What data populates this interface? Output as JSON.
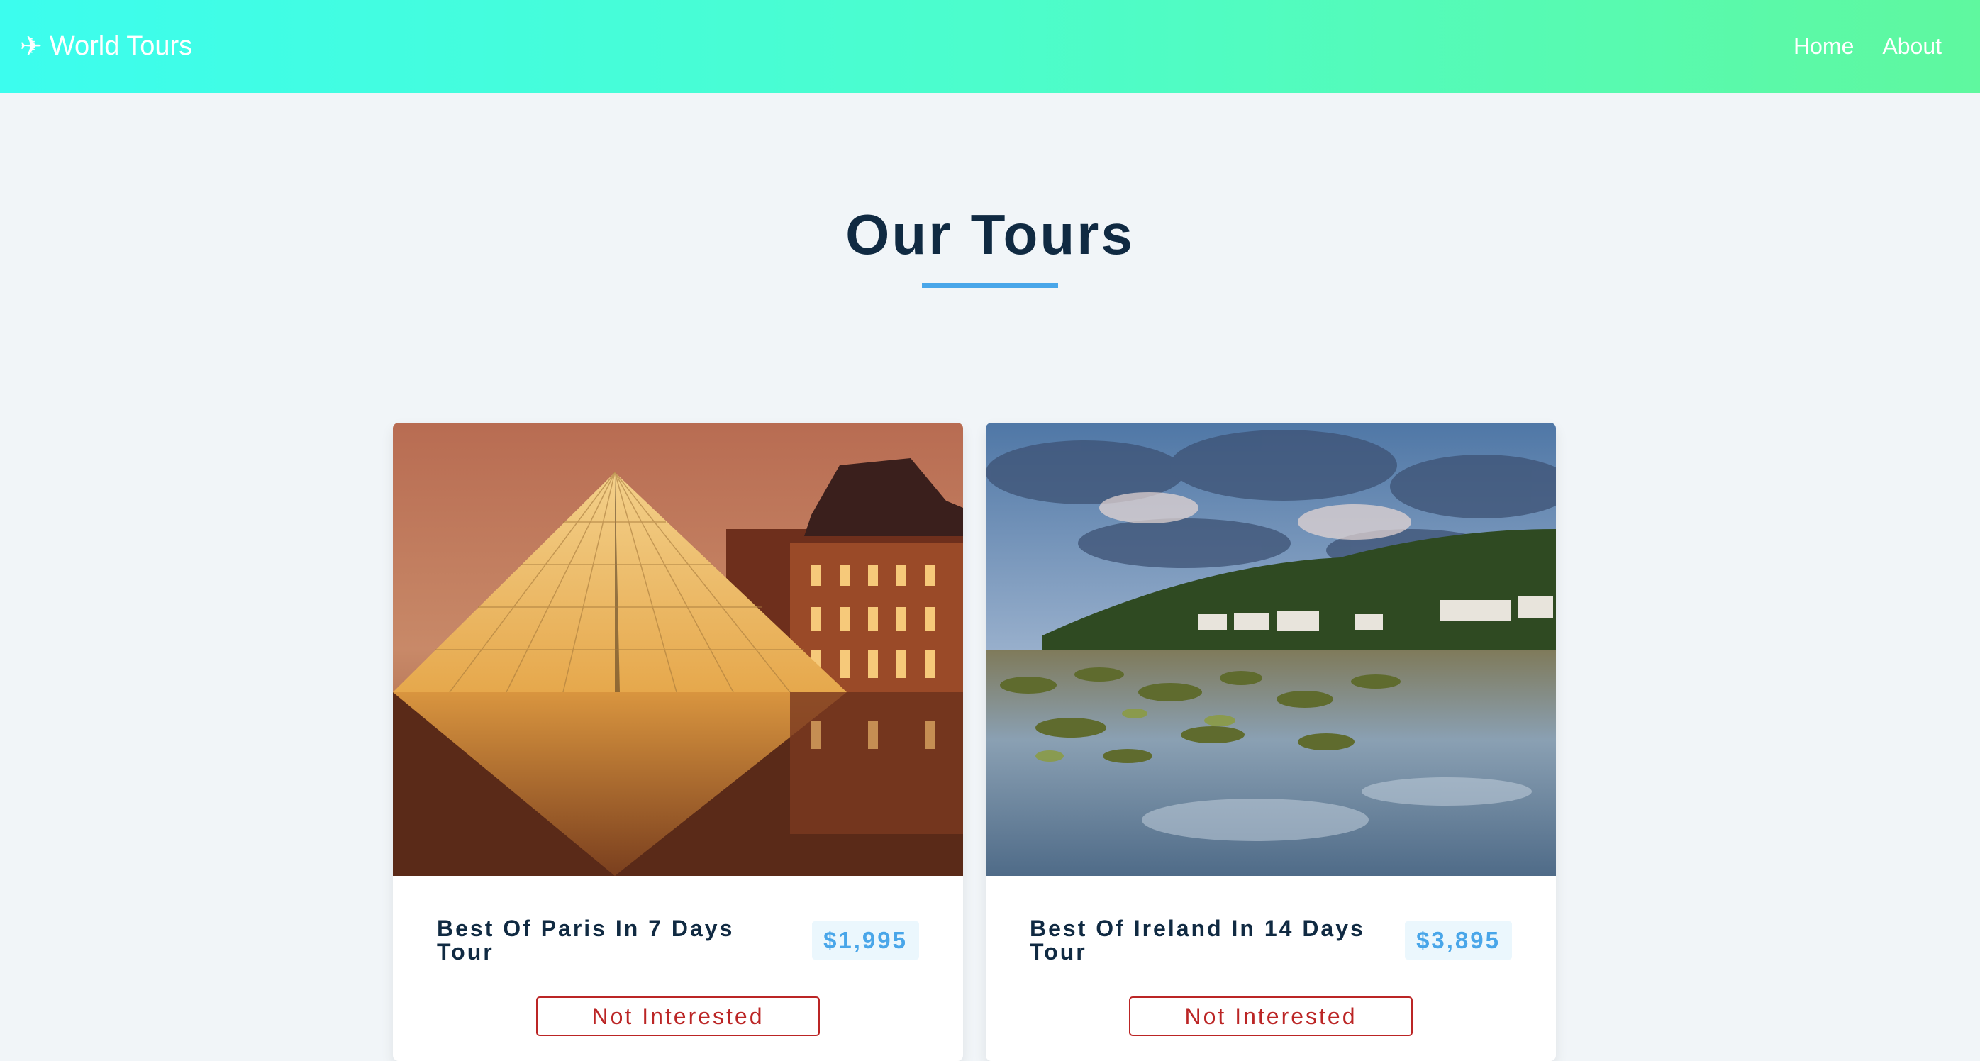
{
  "nav": {
    "brand_icon": "plane-icon",
    "brand": "World Tours",
    "links": [
      "Home",
      "About"
    ]
  },
  "section": {
    "title": "Our Tours"
  },
  "tours": [
    {
      "name": "Best Of Paris In 7 Days Tour",
      "price": "$1,995",
      "button": "Not Interested"
    },
    {
      "name": "Best Of Ireland In 14 Days Tour",
      "price": "$3,895",
      "button": "Not Interested"
    }
  ],
  "colors": {
    "nav_gradient_start": "#3cfdee",
    "nav_gradient_end": "#5ff89f",
    "title": "#102a42",
    "accent": "#49a6e9",
    "danger": "#bb2525"
  }
}
